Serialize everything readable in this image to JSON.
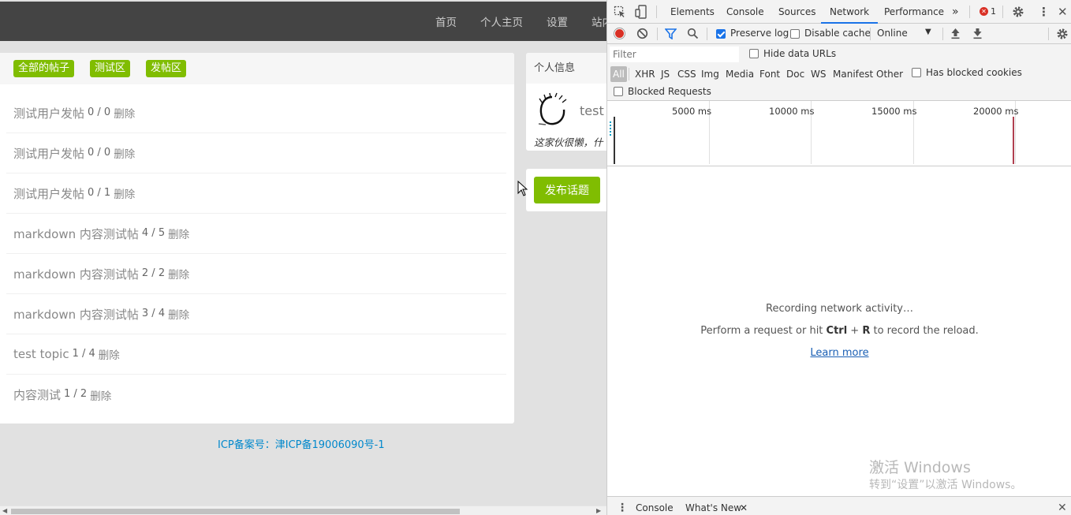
{
  "site": {
    "nav": [
      "首页",
      "个人主页",
      "设置",
      "站内"
    ],
    "tabs": [
      "全部的帖子",
      "测试区",
      "发帖区"
    ],
    "topics": [
      {
        "title": "测试用户发帖",
        "count": "0 / 0",
        "action": "删除"
      },
      {
        "title": "测试用户发帖",
        "count": "0 / 0",
        "action": "删除"
      },
      {
        "title": "测试用户发帖",
        "count": "0 / 1",
        "action": "删除"
      },
      {
        "title": "markdown 内容测试帖",
        "count": "4 / 5",
        "action": "删除"
      },
      {
        "title": "markdown 内容测试帖",
        "count": "2 / 2",
        "action": "删除"
      },
      {
        "title": "markdown 内容测试帖",
        "count": "3 / 4",
        "action": "删除"
      },
      {
        "title": "test topic",
        "count": "1 / 4",
        "action": "删除"
      },
      {
        "title": "内容测试",
        "count": "1 / 2",
        "action": "删除"
      }
    ],
    "profile": {
      "heading": "个人信息",
      "name": "test",
      "signature": "这家伙很懒，什"
    },
    "create_button": "发布话题",
    "footer": "ICP备案号：津ICP备19006090号-1",
    "accent_color": "#80bd01"
  },
  "devtools": {
    "tabs": [
      "Elements",
      "Console",
      "Sources",
      "Network",
      "Performance"
    ],
    "active_tab": "Network",
    "error_count": "1",
    "toolbar": {
      "preserve_log": "Preserve log",
      "preserve_log_checked": true,
      "disable_cache": "Disable cache",
      "disable_cache_checked": false,
      "throttling": "Online"
    },
    "filter": {
      "placeholder": "Filter",
      "hide_data_urls": "Hide data URLs",
      "types": [
        "All",
        "XHR",
        "JS",
        "CSS",
        "Img",
        "Media",
        "Font",
        "Doc",
        "WS",
        "Manifest",
        "Other"
      ],
      "active_type": "All",
      "has_blocked_cookies": "Has blocked cookies",
      "blocked_requests": "Blocked Requests"
    },
    "overview_ticks": [
      "5000 ms",
      "10000 ms",
      "15000 ms",
      "20000 ms"
    ],
    "empty": {
      "title": "Recording network activity…",
      "hint_prefix": "Perform a request or hit ",
      "hint_key1": "Ctrl",
      "hint_plus": " + ",
      "hint_key2": "R",
      "hint_suffix": " to record the reload.",
      "learn_more": "Learn more"
    },
    "watermark": {
      "line1": "激活 Windows",
      "line2": "转到“设置”以激活 Windows。"
    },
    "drawer_tabs": [
      "Console",
      "What's New"
    ],
    "record_color": "#d93025",
    "accent_color": "#1a73e8"
  }
}
